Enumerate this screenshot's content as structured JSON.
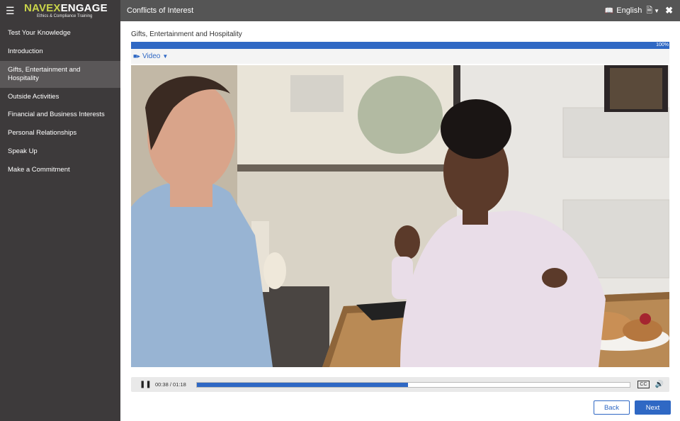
{
  "brand": {
    "logo_navex": "NAVEX",
    "logo_engage": "ENGAGE",
    "logo_sub": "Ethics & Compliance Training"
  },
  "sidebar": {
    "items": [
      {
        "label": "Test Your Knowledge",
        "active": false
      },
      {
        "label": "Introduction",
        "active": false
      },
      {
        "label": "Gifts, Entertainment and Hospitality",
        "active": true
      },
      {
        "label": "Outside Activities",
        "active": false
      },
      {
        "label": "Financial and Business Interests",
        "active": false
      },
      {
        "label": "Personal Relationships",
        "active": false
      },
      {
        "label": "Speak Up",
        "active": false
      },
      {
        "label": "Make a Commitment",
        "active": false
      }
    ]
  },
  "header": {
    "course_title": "Conflicts of Interest",
    "language": "English"
  },
  "main": {
    "page_title": "Gifts, Entertainment and Hospitality",
    "progress_label": "100%",
    "progress_percent": 100,
    "media_toggle_label": "Video"
  },
  "player": {
    "time": "00:38 / 01:18",
    "progress_fraction": 0.487
  },
  "buttons": {
    "back_label": "Back",
    "next_label": "Next"
  },
  "colors": {
    "accent": "#2f68c4",
    "sidebar_bg": "#3d3a3b",
    "header_bg": "#555555",
    "logo_green": "#c9d44a"
  },
  "icons": {
    "menu": "hamburger-icon",
    "language": "language-icon",
    "document": "document-icon",
    "close": "close-icon",
    "video": "video-camera-icon",
    "pause": "pause-icon",
    "captions": "captions-icon",
    "volume": "volume-icon"
  }
}
